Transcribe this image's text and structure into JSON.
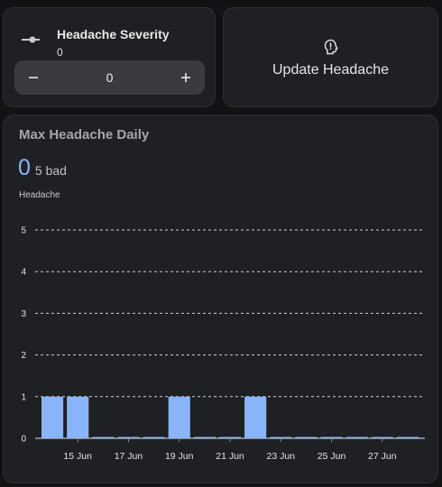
{
  "severity_card": {
    "title": "Headache Severity",
    "value": "0",
    "stepper_value": "0",
    "minus_symbol": "−",
    "plus_symbol": "+"
  },
  "update_card": {
    "label": "Update Headache",
    "icon": "head-alert-icon"
  },
  "chart_card": {
    "title": "Max Headache Daily",
    "current_value": "0",
    "unit": "5 bad",
    "entity_name": "Headache"
  },
  "colors": {
    "accent": "#8ab4f8",
    "card_bg": "#1f2023",
    "page_bg": "#111214"
  },
  "chart_data": {
    "type": "bar",
    "categories": [
      "14 Jun",
      "15 Jun",
      "16 Jun",
      "17 Jun",
      "18 Jun",
      "19 Jun",
      "20 Jun",
      "21 Jun",
      "22 Jun",
      "23 Jun",
      "24 Jun",
      "25 Jun",
      "26 Jun",
      "27 Jun",
      "28 Jun"
    ],
    "values": [
      1,
      1,
      0,
      0,
      0,
      1,
      0,
      0,
      1,
      0,
      0,
      0,
      0,
      0,
      0
    ],
    "x_tick_labels": [
      "15 Jun",
      "17 Jun",
      "19 Jun",
      "21 Jun",
      "23 Jun",
      "25 Jun",
      "27 Jun"
    ],
    "y_ticks": [
      0,
      1,
      2,
      3,
      4,
      5
    ],
    "ylim": [
      0,
      5
    ],
    "ylabel": "Headache",
    "grid": "horizontal dashed",
    "title": ""
  }
}
